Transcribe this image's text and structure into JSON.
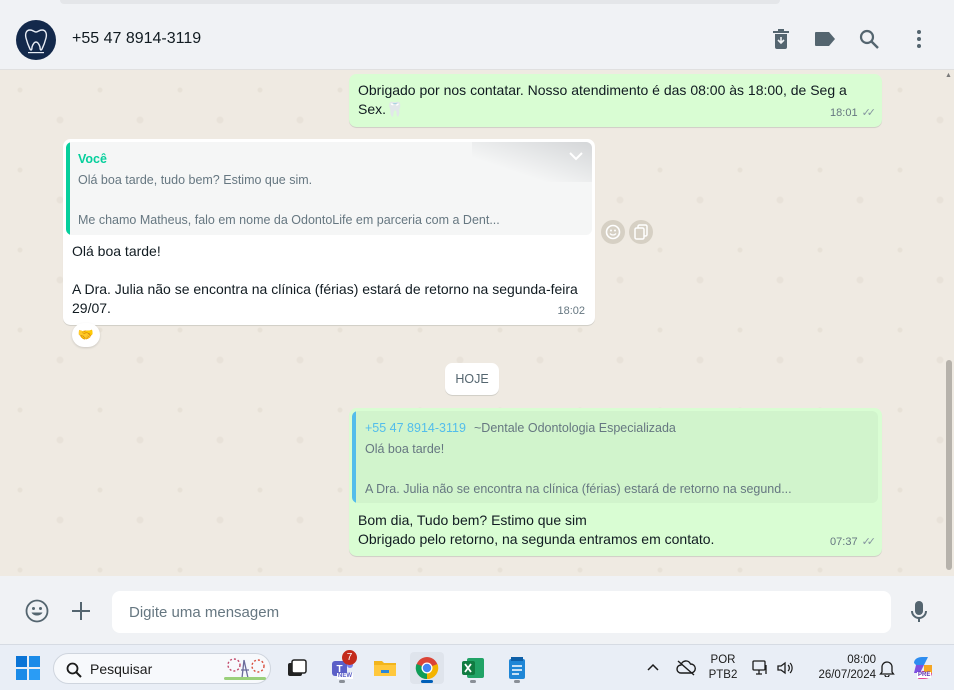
{
  "header": {
    "contact_name": "+55 47 8914-3119",
    "avatar_label": "dentale",
    "icons": [
      "delete-icon",
      "label-icon",
      "search-icon",
      "menu-icon"
    ]
  },
  "messages": {
    "m1": {
      "line1": "Obrigado por nos contatar. Nosso atendimento é das 08:00 às 18:00, de Seg a",
      "line2": "Sex.🦷",
      "time": "18:01"
    },
    "m2": {
      "quote_author": "Você",
      "quote_line1": "Olá boa tarde, tudo bem? Estimo que sim.",
      "quote_line2": "Me chamo Matheus, falo em nome da OdontoLife em parceria com a Dent...",
      "line1": "Olá boa tarde!",
      "line2": "A Dra. Julia não se encontra na clínica (férias) estará de retorno na segunda-feira",
      "line3": "29/07.",
      "time": "18:02",
      "reaction": "🤝"
    },
    "day_divider": "HOJE",
    "m3": {
      "quote_author": "+55 47 8914-3119",
      "quote_author_name": "~Dentale Odontologia Especializada",
      "quote_line1": "Olá boa tarde!",
      "quote_line2": "A Dra. Julia não se encontra na clínica (férias) estará de retorno na segund...",
      "line1": "Bom dia, Tudo bem? Estimo que sim",
      "line2": "Obrigado pelo retorno, na segunda entramos em contato.",
      "time": "07:37"
    }
  },
  "composer": {
    "placeholder": "Digite uma mensagem"
  },
  "taskbar": {
    "search_label": "Pesquisar",
    "teams_badge": "7",
    "teams_tag": "NEW",
    "lang_line1": "POR",
    "lang_line2": "PTB2",
    "time": "08:00",
    "date": "26/07/2024",
    "copilot_tag": "PRE"
  },
  "colors": {
    "outgoing_bubble": "#d9fdd3",
    "incoming_bubble": "#ffffff",
    "chat_bg": "#efeae2",
    "accent_green": "#06cf9c",
    "quote_blue": "#53bdeb"
  }
}
